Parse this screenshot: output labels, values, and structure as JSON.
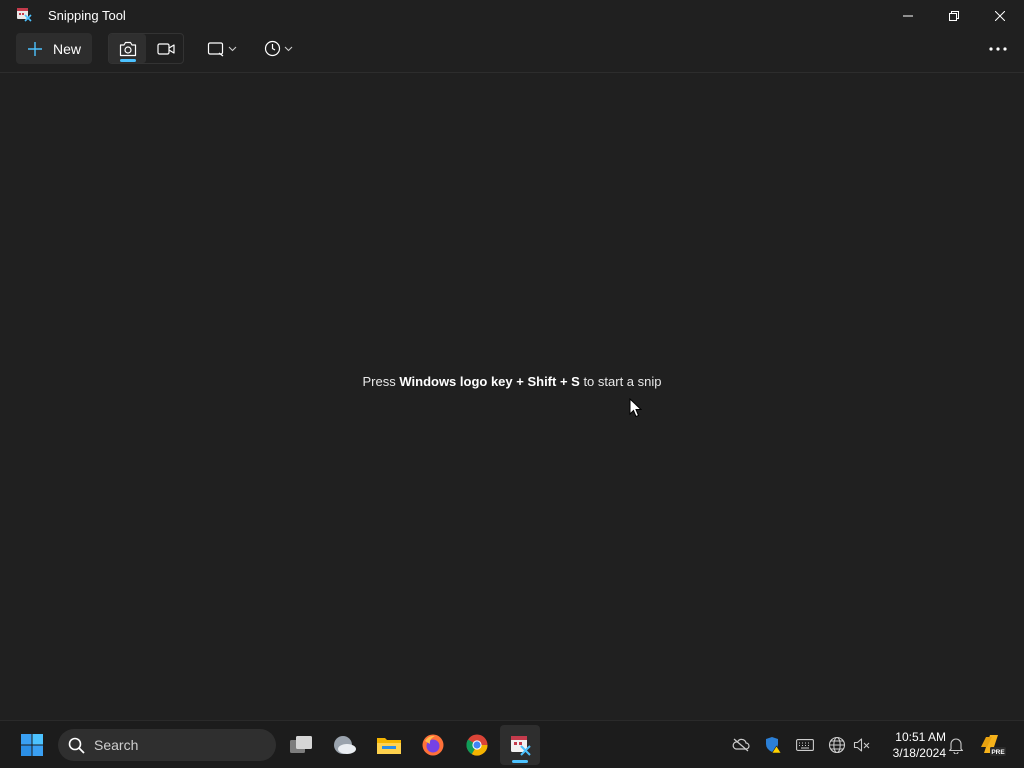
{
  "window": {
    "title": "Snipping Tool",
    "controls": {
      "minimize": "minimize",
      "restore": "restore",
      "close": "close"
    }
  },
  "toolbar": {
    "new_label": "New",
    "modes": [
      {
        "name": "snip",
        "icon": "camera-icon",
        "selected": true
      },
      {
        "name": "record",
        "icon": "video-camera-icon",
        "selected": false
      }
    ],
    "shape_icon": "rectangle-snip-icon",
    "delay_icon": "clock-icon",
    "more_icon": "more-dots-icon",
    "accent": "#4cc2ff"
  },
  "main": {
    "hint_prefix": "Press ",
    "hint_keys": "Windows logo key + Shift + S",
    "hint_suffix": " to start a snip"
  },
  "taskbar": {
    "search_placeholder": "Search",
    "pinned": [
      {
        "name": "start",
        "icon": "windows-logo-icon"
      },
      {
        "name": "task-view",
        "icon": "task-view-icon"
      },
      {
        "name": "weather",
        "icon": "weather-cloud-icon"
      },
      {
        "name": "file-explorer",
        "icon": "folder-icon"
      },
      {
        "name": "firefox",
        "icon": "firefox-icon"
      },
      {
        "name": "chrome",
        "icon": "chrome-icon"
      },
      {
        "name": "snipping-tool",
        "icon": "snipping-tool-icon",
        "active": true
      }
    ],
    "tray": [
      {
        "name": "onedrive",
        "icon": "cloud-offline-icon"
      },
      {
        "name": "security",
        "icon": "shield-warning-icon"
      },
      {
        "name": "keyboard",
        "icon": "keyboard-icon"
      },
      {
        "name": "network",
        "icon": "globe-icon"
      },
      {
        "name": "volume",
        "icon": "speaker-muted-icon"
      }
    ],
    "time": "10:51 AM",
    "date": "3/18/2024",
    "notification_icon": "bell-icon",
    "copilot_badge": "PRE"
  }
}
